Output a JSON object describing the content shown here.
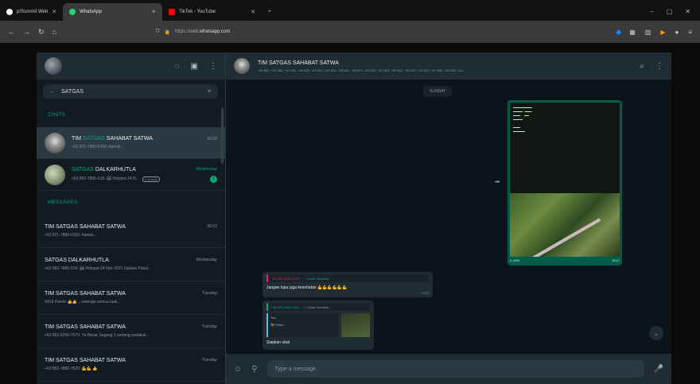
{
  "browser": {
    "tabs": [
      {
        "label": "p/Summit Web",
        "color": "#ffffff"
      },
      {
        "label": "WhatsApp",
        "color": "#25d366"
      },
      {
        "label": "TikTok - YouTube",
        "color": "#ff0000"
      }
    ],
    "new_tab": "+",
    "url": {
      "domain_prefix": "https://web.",
      "domain": "whatsapp.com"
    },
    "window_controls": [
      "–",
      "▢",
      "✕"
    ]
  },
  "sidebar": {
    "search_value": "SATGAS",
    "section_chats": "CHATS",
    "section_messages": "MESSAGES",
    "chat_results": [
      {
        "name_highlight": "SATGAS",
        "name_pre": "TIM ",
        "name_post": " SAHABAT SATWA",
        "time": "00:02",
        "preview": "+62 871-7880-0150: Aamiin...",
        "selected": true
      },
      {
        "name_highlight": "SATGAS",
        "name_pre": "",
        "name_post": " DALKARHUTLA",
        "time": "Wednesday",
        "preview": "+62 852-7865-318: 🖼 Hotspot 24 H...",
        "label": "1 unread",
        "unread": "1",
        "selected": false
      }
    ],
    "message_results": [
      {
        "name": "TIM SATGAS SAHABAT SATWA",
        "time": "00:02",
        "preview": "+62 871-7880-0150: Aamiin..."
      },
      {
        "name": "SATGAS DALKARHUTLA",
        "time": "Wednesday",
        "preview": "+62 852-7865-318: 🖼 Hotspot 24 Nov 2021 Update Pukul..."
      },
      {
        "name": "TIM SATGAS SAHABAT SATWA",
        "time": "Tuesday",
        "preview": "Sfi19 Pande 👍👍 ...semoga semua baik..."
      },
      {
        "name": "TIM SATGAS SAHABAT SATWA",
        "time": "Tuesday",
        "preview": "+62 853-9200-7573: Ya Benar Sagang 1 sedang melakuk..."
      },
      {
        "name": "TIM SATGAS SAHABAT SATWA",
        "time": "Tuesday",
        "preview": "+62 852-7880-7820: 💪💪 👍"
      }
    ]
  },
  "conversation": {
    "title": "TIM SATGAS SAHABAT SATWA",
    "members": "+62 851, +62 852, +62 852, +62 853, +62 812, +62 821, +62 811, +62 813, +62 852, +62 853, +62 812, +62 821, +62 811, +62 852, +62 853, You",
    "date_pill": "SUNDAY",
    "image_msg": {
      "caption": "0.1990",
      "time": "18:47"
    },
    "msg1": {
      "sender": "+62 853-9200-7573",
      "quoted_tag": "~ Lestari Sahabat",
      "text": "Jangan lupa juga kesehatan 💪💪💪💪💪💪",
      "time": "19:02"
    },
    "msg2": {
      "sender": "+62 852-7880-7820",
      "quoted_tag": "~ Lestari Sahabat",
      "card_title": "You",
      "card_sub": "📷 Photo",
      "caption": "Siapkan obat"
    },
    "input_placeholder": "Type a message"
  }
}
